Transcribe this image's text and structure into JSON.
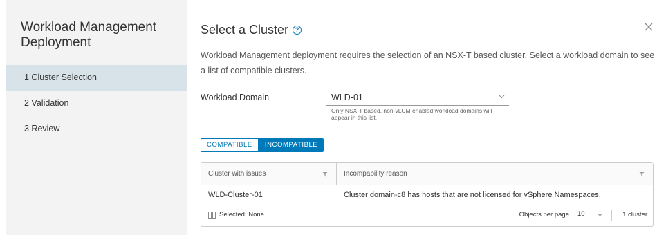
{
  "sidebar": {
    "title": "Workload Management Deployment",
    "steps": [
      {
        "label": "1  Cluster Selection",
        "active": true
      },
      {
        "label": "2  Validation",
        "active": false
      },
      {
        "label": "3  Review",
        "active": false
      }
    ]
  },
  "main": {
    "title": "Select a Cluster",
    "help_icon": "?",
    "description": "Workload Management deployment requires the selection of an NSX-T based cluster. Select a workload domain to see a list of compatible clusters.",
    "workload_domain": {
      "label": "Workload Domain",
      "value": "WLD-01",
      "hint": "Only NSX-T based, non-vLCM enabled workload domains will appear in this list."
    },
    "toggle": {
      "compatible_label": "COMPATIBLE",
      "incompatible_label": "INCOMPATIBLE",
      "selected": "INCOMPATIBLE"
    },
    "table": {
      "columns": [
        "Cluster with issues",
        "Incompability reason"
      ],
      "rows": [
        [
          "WLD-Cluster-01",
          "Cluster domain-c8 has hosts that are not licensed for vSphere Namespaces."
        ]
      ],
      "footer": {
        "selected": "Selected: None",
        "per_page_label": "Objects per page",
        "per_page_value": "10",
        "count": "1 cluster"
      }
    }
  },
  "colors": {
    "accent": "#0079b8",
    "active_step_bg": "#d8e3e9",
    "sidebar_bg": "#f3f3f3"
  }
}
